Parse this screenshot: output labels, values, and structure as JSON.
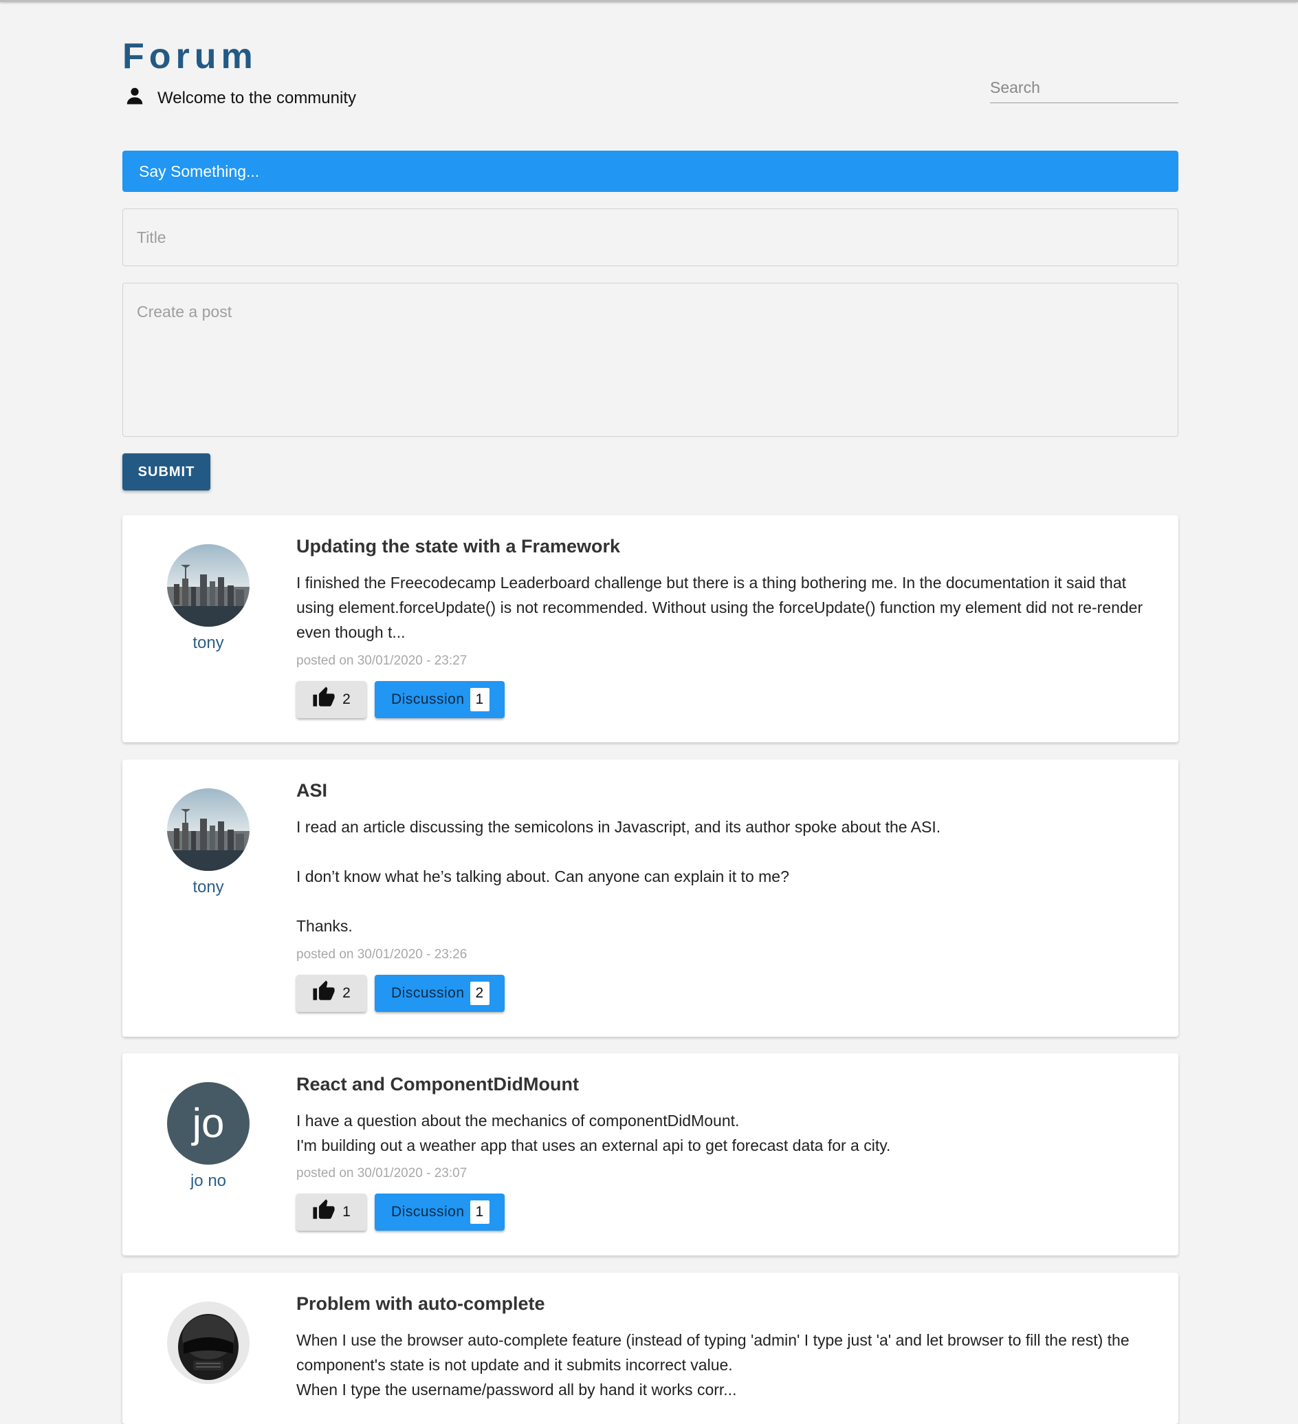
{
  "header": {
    "brand": "Forum",
    "welcome": "Welcome to the community",
    "search_placeholder": "Search"
  },
  "composer": {
    "say_label": "Say Something...",
    "title_placeholder": "Title",
    "post_placeholder": "Create a post",
    "submit_label": "SUBMIT"
  },
  "posts": [
    {
      "author": "tony",
      "title": "Updating the state with a Framework",
      "body": [
        "I finished the Freecodecamp Leaderboard challenge but there is a thing bothering me. In the documentation it said that using element.forceUpdate() is not recommended. Without using the forceUpdate() function my element did not re-render even though t..."
      ],
      "posted": "posted on 30/01/2020 - 23:27",
      "likes": "2",
      "discussion_label": "Discussion",
      "discussion_count": "1"
    },
    {
      "author": "tony",
      "title": "ASI",
      "body": [
        "I read an article discussing the semicolons in Javascript, and its author spoke about the ASI.",
        "I don’t know what he’s talking about. Can anyone can explain it to me?",
        "Thanks."
      ],
      "posted": "posted on 30/01/2020 - 23:26",
      "likes": "2",
      "discussion_label": "Discussion",
      "discussion_count": "2"
    },
    {
      "author": "jo no",
      "avatar_initials": "jo",
      "title": "React and ComponentDidMount",
      "body": [
        "I have a question about the mechanics of componentDidMount.",
        "I'm building out a weather app that uses an external api to get forecast data for a city."
      ],
      "posted": "posted on 30/01/2020 - 23:07",
      "likes": "1",
      "discussion_label": "Discussion",
      "discussion_count": "1"
    },
    {
      "title": "Problem with auto-complete",
      "body": [
        "When I use the browser auto-complete feature (instead of typing 'admin' I type just 'a' and let browser to fill the rest) the component's state is not update and it submits incorrect value.",
        "When I type the username/password all by hand it works corr..."
      ]
    }
  ],
  "colors": {
    "brand": "#235a85",
    "accent": "#2196f3",
    "submit": "#235a85",
    "background": "#f3f3f3"
  },
  "icons": {
    "user": "person-icon",
    "like": "thumbs-up-icon"
  }
}
